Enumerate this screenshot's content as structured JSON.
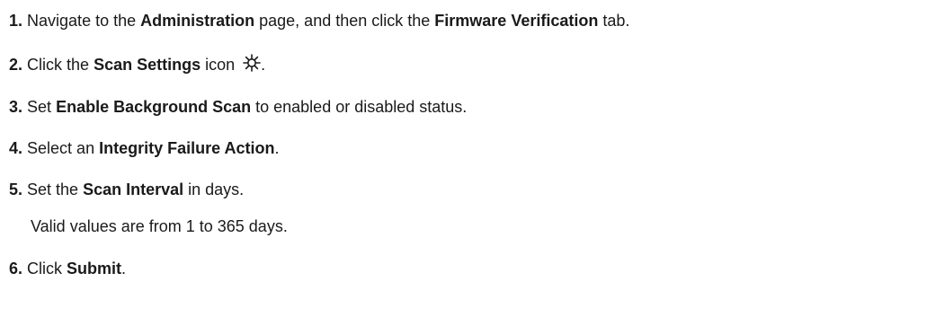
{
  "steps": [
    {
      "num": "1.",
      "parts": [
        "Navigate to the ",
        "Administration",
        " page, and then click the ",
        "Firmware Verification",
        " tab."
      ]
    },
    {
      "num": "2.",
      "parts": [
        "Click the ",
        "Scan Settings",
        " icon ",
        "."
      ],
      "icon": "scan-settings-gear-icon"
    },
    {
      "num": "3.",
      "parts": [
        "Set ",
        "Enable Background Scan",
        " to enabled or disabled status."
      ]
    },
    {
      "num": "4.",
      "parts": [
        "Select an ",
        "Integrity Failure Action",
        "."
      ]
    },
    {
      "num": "5.",
      "parts": [
        "Set the ",
        "Scan Interval",
        " in days."
      ],
      "note": "Valid values are from 1 to 365 days."
    },
    {
      "num": "6.",
      "parts": [
        "Click ",
        "Submit",
        "."
      ]
    }
  ]
}
